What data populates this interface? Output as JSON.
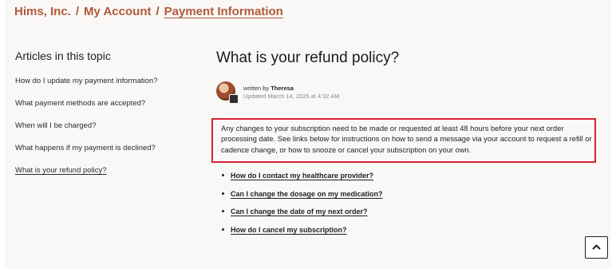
{
  "breadcrumb": {
    "items": [
      "Hims, Inc.",
      "My Account",
      "Payment Information"
    ],
    "separator": "/"
  },
  "sidebar": {
    "title": "Articles in this topic",
    "items": [
      {
        "label": "How do I update my payment information?"
      },
      {
        "label": "What payment methods are accepted?"
      },
      {
        "label": "When will I be charged?"
      },
      {
        "label": "What happens if my payment is declined?"
      },
      {
        "label": "What is your refund policy?",
        "active": true
      }
    ]
  },
  "article": {
    "title": "What is your refund policy?",
    "author": {
      "written_by_prefix": "written by",
      "name": "Theresa",
      "updated": "Updated March 14, 2025 at 4:32 AM"
    },
    "body": "Any changes to your subscription need to be made or requested at least 48 hours before your next order processing date. See links below for instructions on how to send a message via your account to request a refill or cadence change, or how to snooze or cancel your subscription on your own.",
    "links": [
      {
        "label": "How do I contact my healthcare provider?"
      },
      {
        "label": "Can I change the dosage on my medication?"
      },
      {
        "label": "Can I change the date of my next order?"
      },
      {
        "label": "How do I cancel my subscription?"
      }
    ]
  },
  "colors": {
    "breadcrumb": "#b0593a",
    "highlight_border": "#d62235",
    "page_background": "#f9f8f6"
  },
  "icons": {
    "scroll_top": "chevron-up-icon",
    "avatar_badge": "agent-badge-icon"
  }
}
